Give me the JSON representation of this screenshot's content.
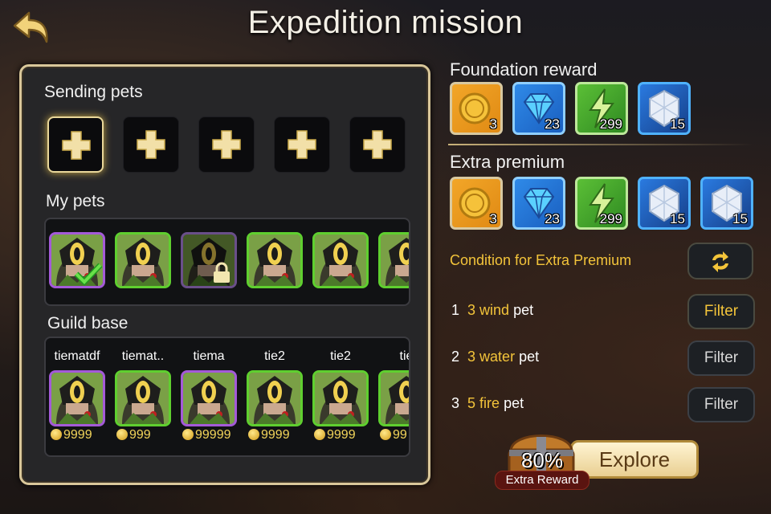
{
  "header": {
    "title": "Expedition mission",
    "back_icon": "back-arrow-icon"
  },
  "sending": {
    "label": "Sending pets",
    "slots": 5,
    "slot_icon": "plus-icon"
  },
  "my_pets": {
    "label": "My pets",
    "pets": [
      {
        "frame": "purple",
        "state": "selected",
        "overlay": "check-icon"
      },
      {
        "frame": "green",
        "state": "normal"
      },
      {
        "frame": "purple",
        "state": "locked",
        "overlay": "lock-icon"
      },
      {
        "frame": "green",
        "state": "normal"
      },
      {
        "frame": "green",
        "state": "normal"
      },
      {
        "frame": "green",
        "state": "normal"
      }
    ]
  },
  "guild": {
    "label": "Guild base",
    "names": [
      "tiematdf",
      "tiemat..",
      "tiema",
      "tie2",
      "tie2",
      "tie"
    ],
    "coins": [
      "9999",
      "999",
      "99999",
      "9999",
      "9999",
      "99"
    ],
    "frames": [
      "purple",
      "green",
      "purple",
      "green",
      "green",
      "green"
    ]
  },
  "foundation": {
    "label": "Foundation reward",
    "items": [
      {
        "type": "coin",
        "icon": "coin-icon",
        "count": "3"
      },
      {
        "type": "gem",
        "icon": "diamond-icon",
        "count": "23"
      },
      {
        "type": "energy",
        "icon": "energy-icon",
        "count": "299"
      },
      {
        "type": "crystal",
        "icon": "crystal-icon",
        "count": "15"
      }
    ]
  },
  "premium": {
    "label": "Extra premium",
    "items": [
      {
        "type": "coin",
        "icon": "coin-icon",
        "count": "3"
      },
      {
        "type": "gem",
        "icon": "diamond-icon",
        "count": "23"
      },
      {
        "type": "energy",
        "icon": "energy-icon",
        "count": "299"
      },
      {
        "type": "crystal",
        "icon": "crystal-icon",
        "count": "15"
      },
      {
        "type": "crystal",
        "icon": "crystal-icon",
        "count": "15"
      }
    ]
  },
  "condition": {
    "label": "Condition for Extra Premium",
    "refresh_icon": "refresh-icon",
    "requirements": [
      {
        "num": "1",
        "amount": "3 wind",
        "suffix": "pet",
        "filter": "Filter",
        "active": true
      },
      {
        "num": "2",
        "amount": "3 water",
        "suffix": "pet",
        "filter": "Filter",
        "active": false
      },
      {
        "num": "3",
        "amount": "5 fire",
        "suffix": "pet",
        "filter": "Filter",
        "active": false
      }
    ]
  },
  "explore": {
    "button": "Explore",
    "percent": "80%",
    "tag": "Extra Reward",
    "chest_icon": "treasure-chest-icon"
  },
  "colors": {
    "accent": "#f3c43a",
    "green_frame": "#5fcf2f",
    "purple_frame": "#a45ad8",
    "panel_border": "#d9c79a"
  }
}
